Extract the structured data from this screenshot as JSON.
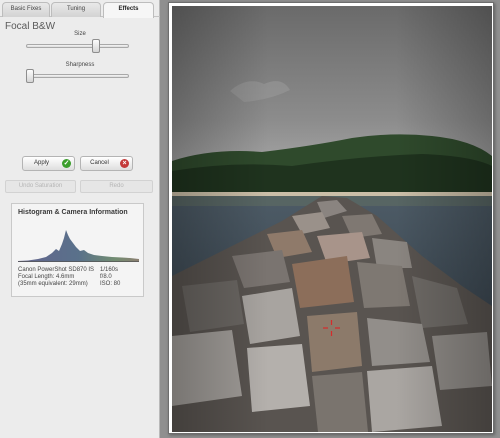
{
  "tabs": [
    {
      "label": "Basic Fixes"
    },
    {
      "label": "Tuning"
    },
    {
      "label": "Effects"
    }
  ],
  "panel": {
    "title": "Focal B&W",
    "sliders": [
      {
        "label": "Size",
        "value": 0.68
      },
      {
        "label": "Sharpness",
        "value": 0.03
      }
    ]
  },
  "buttons": {
    "apply": "Apply",
    "cancel": "Cancel",
    "undo": "Undo Saturation",
    "redo": "Redo"
  },
  "icons": {
    "apply": "check-icon",
    "cancel": "x-icon"
  },
  "histogram": {
    "title": "Histogram & Camera Information",
    "camera_left": [
      "Canon PowerShot SD870 IS",
      "Focal Length: 4.6mm",
      "(35mm equivalent:  29mm)"
    ],
    "camera_right": [
      "1/160s",
      "f/8.0",
      "ISO: 80"
    ]
  },
  "colors": {
    "panel_bg": "#ececec",
    "apply_icon": "#3b9e2c",
    "cancel_icon": "#c43a3a",
    "focus_marker": "#d62b2b"
  }
}
